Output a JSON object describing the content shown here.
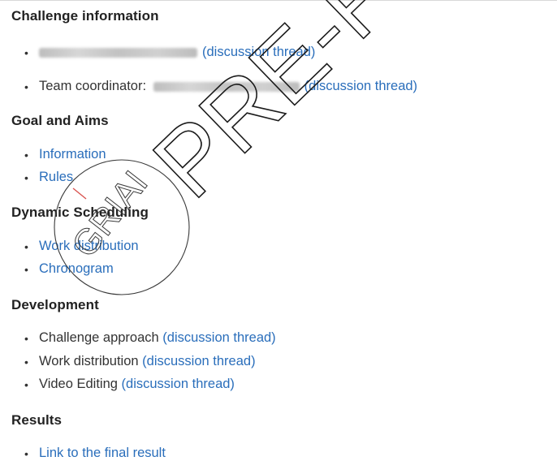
{
  "sections": {
    "challenge_information": {
      "heading": "Challenge information",
      "items": [
        {
          "link": "(discussion thread)"
        },
        {
          "prefix": "Team coordinator: ",
          "link": "(discussion thread)"
        }
      ]
    },
    "goal_and_aims": {
      "heading": "Goal and Aims",
      "items": [
        {
          "link": "Information"
        },
        {
          "link": "Rules"
        }
      ]
    },
    "dynamic_scheduling": {
      "heading": "Dynamic Scheduling",
      "items": [
        {
          "link": "Work distribution"
        },
        {
          "link": "Chronogram"
        }
      ]
    },
    "development": {
      "heading": "Development",
      "items": [
        {
          "prefix": "Challenge approach ",
          "link": "(discussion thread)"
        },
        {
          "prefix": "Work distribution ",
          "link": "(discussion thread)"
        },
        {
          "prefix": "Video Editing ",
          "link": "(discussion thread)"
        }
      ]
    },
    "results": {
      "heading": "Results",
      "items": [
        {
          "link": "Link to the final result"
        }
      ]
    }
  },
  "bullet_char": "•",
  "watermark": {
    "large_text": "PRE-F",
    "stamp_text": "GRIAI"
  },
  "colors": {
    "link": "#2a6ebb",
    "text": "#333333",
    "heading": "#222222"
  }
}
